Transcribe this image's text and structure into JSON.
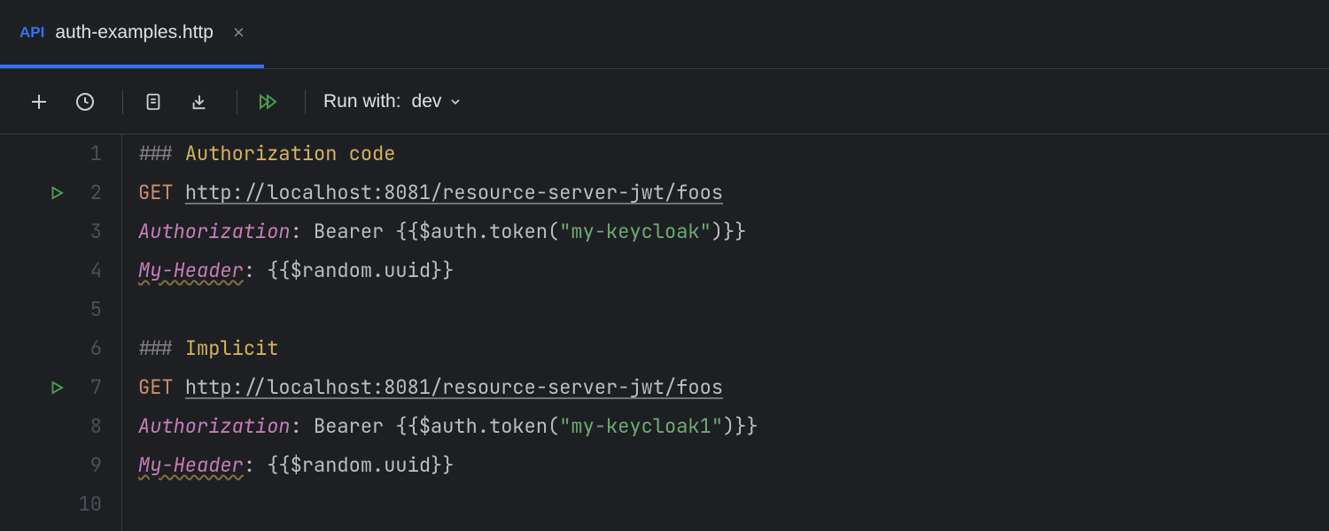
{
  "tab": {
    "badge": "API",
    "filename": "auth-examples.http",
    "close": "×"
  },
  "toolbar": {
    "run_with_label": "Run with:",
    "environment": "dev"
  },
  "gutter": {
    "lines": [
      "1",
      "2",
      "3",
      "4",
      "5",
      "6",
      "7",
      "8",
      "9",
      "10"
    ]
  },
  "code": {
    "l1": {
      "hash": "### ",
      "section": "Authorization code"
    },
    "l2": {
      "method": "GET ",
      "url": "http://localhost:8081/resource-server-jwt/foos"
    },
    "l3": {
      "header": "Authorization",
      "colon": ": ",
      "pre": "Bearer ",
      "open": "{{",
      "expr": "$auth.token",
      "paren_o": "(",
      "str": "\"my-keycloak\"",
      "paren_c": ")",
      "close": "}}"
    },
    "l4": {
      "header": "My-Header",
      "colon": ": ",
      "open": "{{",
      "expr": "$random.uuid",
      "close": "}}"
    },
    "l6": {
      "hash": "### ",
      "section": "Implicit"
    },
    "l7": {
      "method": "GET ",
      "url": "http://localhost:8081/resource-server-jwt/foos"
    },
    "l8": {
      "header": "Authorization",
      "colon": ": ",
      "pre": "Bearer ",
      "open": "{{",
      "expr": "$auth.token",
      "paren_o": "(",
      "str": "\"my-keycloak1\"",
      "paren_c": ")",
      "close": "}}"
    },
    "l9": {
      "header": "My-Header",
      "colon": ": ",
      "open": "{{",
      "expr": "$random.uuid",
      "close": "}}"
    }
  }
}
